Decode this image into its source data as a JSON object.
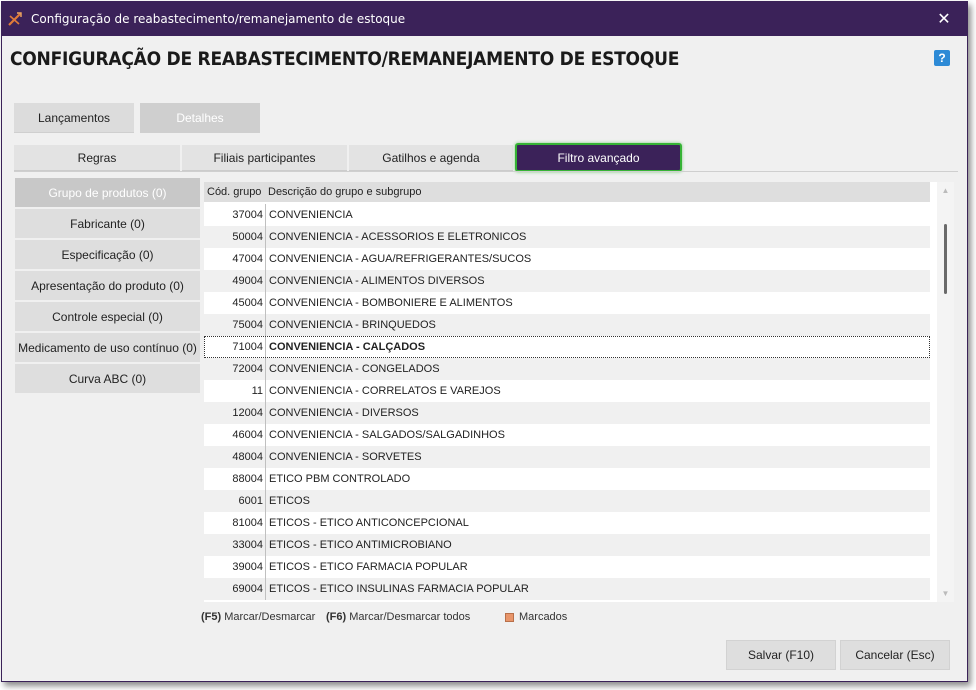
{
  "window": {
    "title": "Configuração de reabastecimento/remanejamento de estoque",
    "close_glyph": "✕"
  },
  "page": {
    "title": "CONFIGURAÇÃO DE REABASTECIMENTO/REMANEJAMENTO DE ESTOQUE",
    "help_label": "?"
  },
  "main_tabs": [
    "Lançamentos",
    "Detalhes"
  ],
  "sub_tabs": [
    "Regras",
    "Filiais participantes",
    "Gatilhos e agenda",
    "Filtro avançado"
  ],
  "sidebar": [
    "Grupo de produtos (0)",
    "Fabricante (0)",
    "Especificação (0)",
    "Apresentação do produto (0)",
    "Controle especial (0)",
    "Medicamento de uso contínuo (0)",
    "Curva ABC (0)"
  ],
  "grid": {
    "columns": [
      "Cód. grupo",
      "Descrição do grupo e subgrupo"
    ],
    "rows": [
      {
        "code": "37004",
        "desc": "CONVENIENCIA"
      },
      {
        "code": "50004",
        "desc": "CONVENIENCIA - ACESSORIOS E ELETRONICOS"
      },
      {
        "code": "47004",
        "desc": "CONVENIENCIA - AGUA/REFRIGERANTES/SUCOS"
      },
      {
        "code": "49004",
        "desc": "CONVENIENCIA - ALIMENTOS DIVERSOS"
      },
      {
        "code": "45004",
        "desc": "CONVENIENCIA - BOMBONIERE E ALIMENTOS"
      },
      {
        "code": "75004",
        "desc": "CONVENIENCIA - BRINQUEDOS"
      },
      {
        "code": "71004",
        "desc": "CONVENIENCIA - CALÇADOS"
      },
      {
        "code": "72004",
        "desc": "CONVENIENCIA - CONGELADOS"
      },
      {
        "code": "11",
        "desc": "CONVENIENCIA - CORRELATOS E VAREJOS"
      },
      {
        "code": "12004",
        "desc": "CONVENIENCIA - DIVERSOS"
      },
      {
        "code": "46004",
        "desc": "CONVENIENCIA - SALGADOS/SALGADINHOS"
      },
      {
        "code": "48004",
        "desc": "CONVENIENCIA - SORVETES"
      },
      {
        "code": "88004",
        "desc": "ETICO PBM CONTROLADO"
      },
      {
        "code": "6001",
        "desc": "ETICOS"
      },
      {
        "code": "81004",
        "desc": "ETICOS - ETICO ANTICONCEPCIONAL"
      },
      {
        "code": "33004",
        "desc": "ETICOS - ETICO ANTIMICROBIANO"
      },
      {
        "code": "39004",
        "desc": "ETICOS - ETICO FARMACIA POPULAR"
      },
      {
        "code": "69004",
        "desc": "ETICOS - ETICO INSULINAS FARMACIA POPULAR"
      }
    ]
  },
  "hints": {
    "f5_key": "(F5)",
    "f5_label": "Marcar/Desmarcar",
    "f6_key": "(F6)",
    "f6_label": "Marcar/Desmarcar todos",
    "legend_label": "Marcados"
  },
  "colors": {
    "titlebar": "#3b2259",
    "active_tab_border": "#36b335",
    "marked_swatch": "#e8956a"
  },
  "buttons": {
    "save": "Salvar (F10)",
    "cancel": "Cancelar (Esc)"
  }
}
